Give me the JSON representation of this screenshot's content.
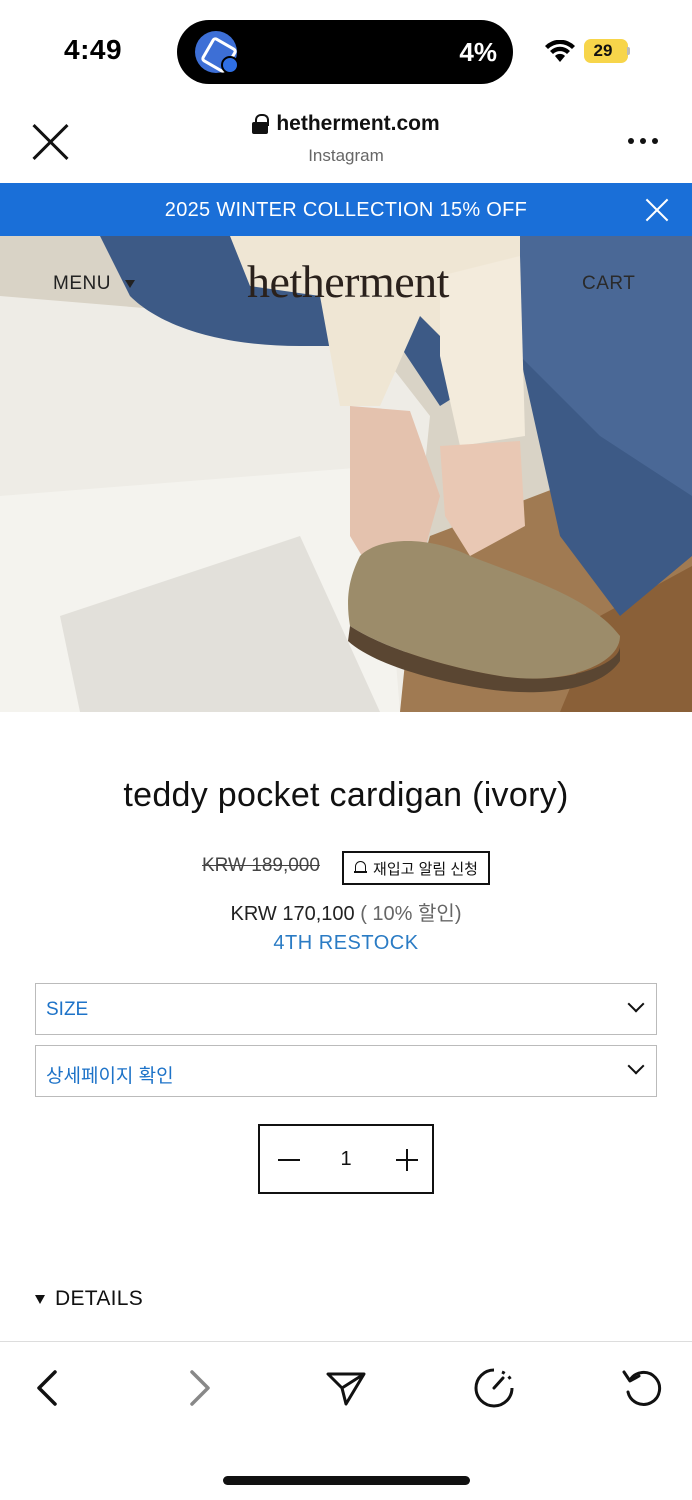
{
  "status_bar": {
    "time": "4:49",
    "activity_percent": "4%",
    "battery": "29",
    "battery_color": "#f7d54a"
  },
  "browser": {
    "domain": "hetherment.com",
    "source": "Instagram"
  },
  "promo": {
    "text": "2025 WINTER COLLECTION 15% OFF",
    "color": "#1a6fd8"
  },
  "site_nav": {
    "menu_label": "MENU",
    "logo_text": "hetherment",
    "cart_label": "CART"
  },
  "product": {
    "title": "teddy pocket cardigan (ivory)",
    "original_price": "KRW 189,000",
    "restock_alert_button": "재입고 알림 신청",
    "sale_price": "KRW 170,100",
    "discount": " ( 10% 할인)",
    "restock_label": "4TH RESTOCK",
    "accent_color": "#1e73c8"
  },
  "options": {
    "size_label": "SIZE",
    "detail_label": "상세페이지 확인"
  },
  "quantity": {
    "value": "1"
  },
  "details_label": "DETAILS",
  "toolbar_icons": [
    "back-icon",
    "forward-icon",
    "share-icon",
    "speed-icon",
    "refresh-icon"
  ]
}
